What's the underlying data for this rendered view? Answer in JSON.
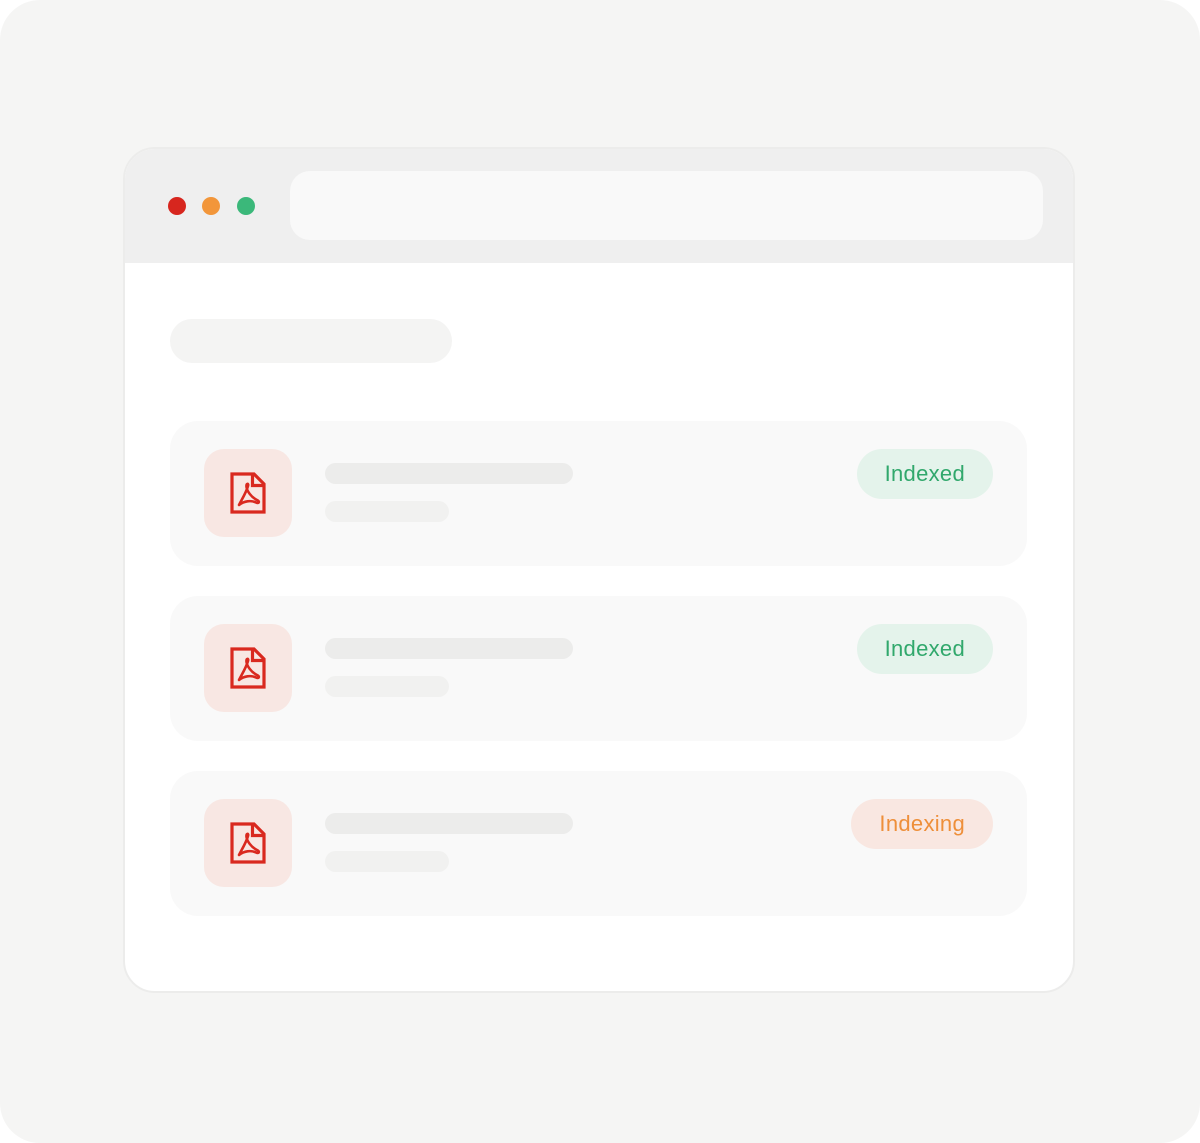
{
  "colors": {
    "dot_red": "#d7261e",
    "dot_orange": "#f2963a",
    "dot_green": "#3bb87a",
    "pdf_icon": "#d9291f",
    "indexed_text": "#31a86c",
    "indexed_bg": "#e4f3eb",
    "indexing_text": "#ee8f3a",
    "indexing_bg": "#f9e7e1"
  },
  "files": [
    {
      "icon": "pdf-icon",
      "status": "Indexed",
      "status_type": "indexed"
    },
    {
      "icon": "pdf-icon",
      "status": "Indexed",
      "status_type": "indexed"
    },
    {
      "icon": "pdf-icon",
      "status": "Indexing",
      "status_type": "indexing"
    }
  ]
}
